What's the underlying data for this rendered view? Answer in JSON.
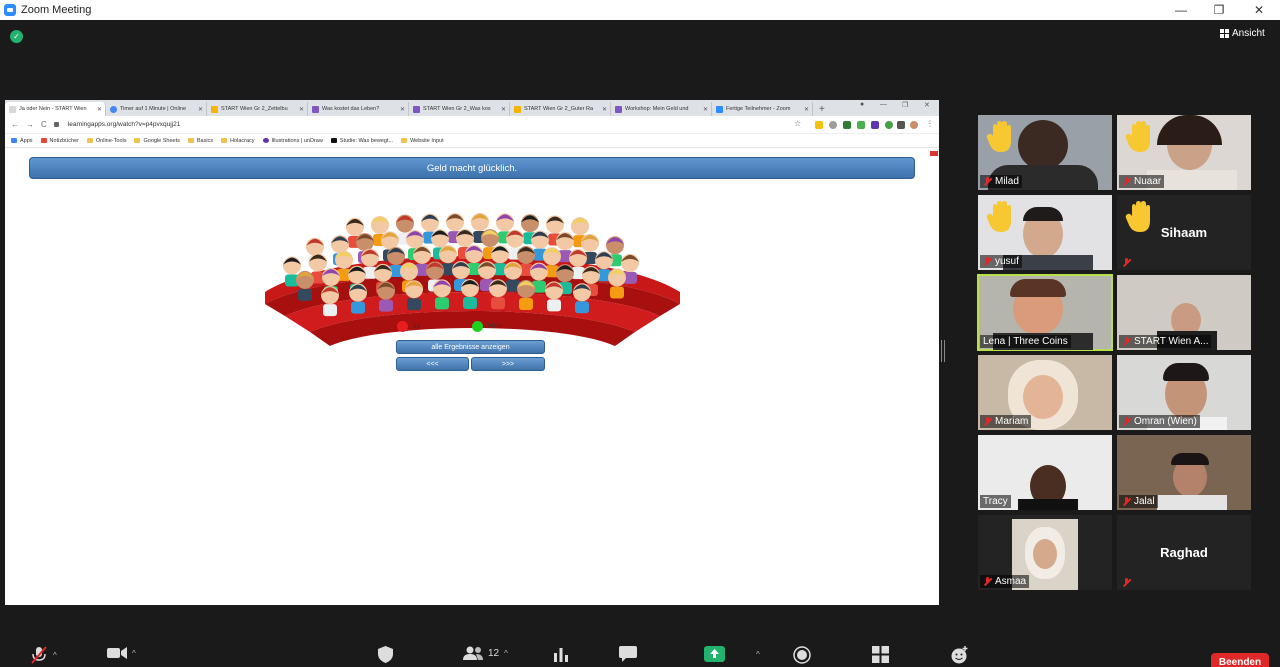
{
  "window": {
    "title": "Zoom Meeting",
    "view_label": "Ansicht"
  },
  "browser": {
    "tabs": [
      {
        "label": "Ja oder Nein - START Wien",
        "color": "#d9d9d9"
      },
      {
        "label": "Timer auf 1 Minute | Online",
        "color": "#4285f4"
      },
      {
        "label": "START Wien Gr 2_Zettelbu",
        "color": "#f4b400"
      },
      {
        "label": "Was kostet das Leben?",
        "color": "#7e57c2"
      },
      {
        "label": "START Wien Gr 2_Was kos",
        "color": "#7e57c2"
      },
      {
        "label": "START Wien Gr 2_Guter Ra",
        "color": "#f4b400"
      },
      {
        "label": "Workshop: Mein Geld und",
        "color": "#7e57c2"
      },
      {
        "label": "Fertige Teilnehmer - Zoom",
        "color": "#2d8cff"
      }
    ],
    "url": "learningapps.org/watch?v=p4pvxqujj21",
    "bookmarks": [
      "Apps",
      "Notizbücher",
      "Online-Tools",
      "Google Sheets",
      "Basics",
      "Holacracy",
      "Illustrations | unDraw",
      "Studie: Was bewegt...",
      "Website Input"
    ]
  },
  "app": {
    "question": "Geld macht glücklich.",
    "legend_yes": "Ja",
    "legend_no": "Nein",
    "color_yes": "#e81e1e",
    "color_no": "#1ed21e",
    "show_all_button": "alle Ergebnisse anzeigen",
    "prev_button": "<<<",
    "next_button": ">>>"
  },
  "participants": [
    {
      "name": "Milad",
      "raised_hand": true
    },
    {
      "name": "Nuaar",
      "raised_hand": true
    },
    {
      "name": "yusuf",
      "raised_hand": true
    },
    {
      "name": "Sihaam",
      "raised_hand": true
    },
    {
      "name": "Lena | Three Coins",
      "active_speaker": true
    },
    {
      "name": "START Wien A..."
    },
    {
      "name": "Mariam"
    },
    {
      "name": "Omran (Wien)"
    },
    {
      "name": "Tracy"
    },
    {
      "name": "Jalal"
    },
    {
      "name": "Asmaa"
    },
    {
      "name": "Raghad"
    }
  ],
  "toolbar": {
    "participant_count": "12",
    "end_label": "Beenden"
  }
}
